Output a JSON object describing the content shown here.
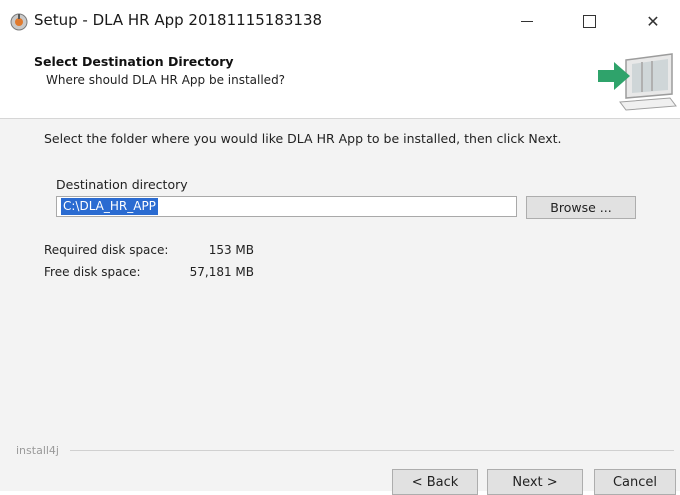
{
  "window": {
    "title": "Setup - DLA HR App 20181115183138",
    "controls": {
      "minimize": "minimize",
      "maximize": "maximize",
      "close": "close"
    }
  },
  "header": {
    "title": "Select Destination Directory",
    "subtitle": "Where should DLA HR App be installed?"
  },
  "main": {
    "instruction": "Select the folder where you would like DLA HR App to be installed, then click Next.",
    "destination_label": "Destination directory",
    "destination_value": "C:\\DLA_HR_APP",
    "browse_label": "Browse ...",
    "required_space_label": "Required disk space:",
    "required_space_value": "153 MB",
    "free_space_label": "Free disk space:",
    "free_space_value": "57,181 MB"
  },
  "footer": {
    "brand": "install4j",
    "back_label": "< Back",
    "next_label": "Next >",
    "cancel_label": "Cancel"
  },
  "colors": {
    "selection": "#2a6bd1",
    "accent_green": "#2fa36b"
  },
  "icons": {
    "app": "setup-app-icon",
    "header": "computer-install-arrow-icon"
  }
}
